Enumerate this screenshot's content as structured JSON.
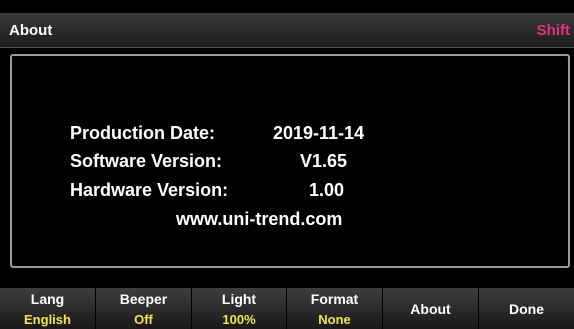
{
  "header": {
    "title": "About",
    "shift": "Shift"
  },
  "info": {
    "production_date_label": "Production Date:",
    "production_date": "2019-11-14",
    "software_version_label": "Software Version:",
    "software_version": "V1.65",
    "hardware_version_label": "Hardware Version:",
    "hardware_version": "1.00",
    "website": "www.uni-trend.com"
  },
  "softkeys": [
    {
      "label": "Lang",
      "value": "English"
    },
    {
      "label": "Beeper",
      "value": "Off"
    },
    {
      "label": "Light",
      "value": "100%"
    },
    {
      "label": "Format",
      "value": "None"
    },
    {
      "label": "About",
      "value": ""
    },
    {
      "label": "Done",
      "value": ""
    }
  ],
  "colors": {
    "shift": "#e8327a",
    "softkey_value": "#f2e44a",
    "background": "#000000",
    "panel_border": "#9a9a9a"
  }
}
